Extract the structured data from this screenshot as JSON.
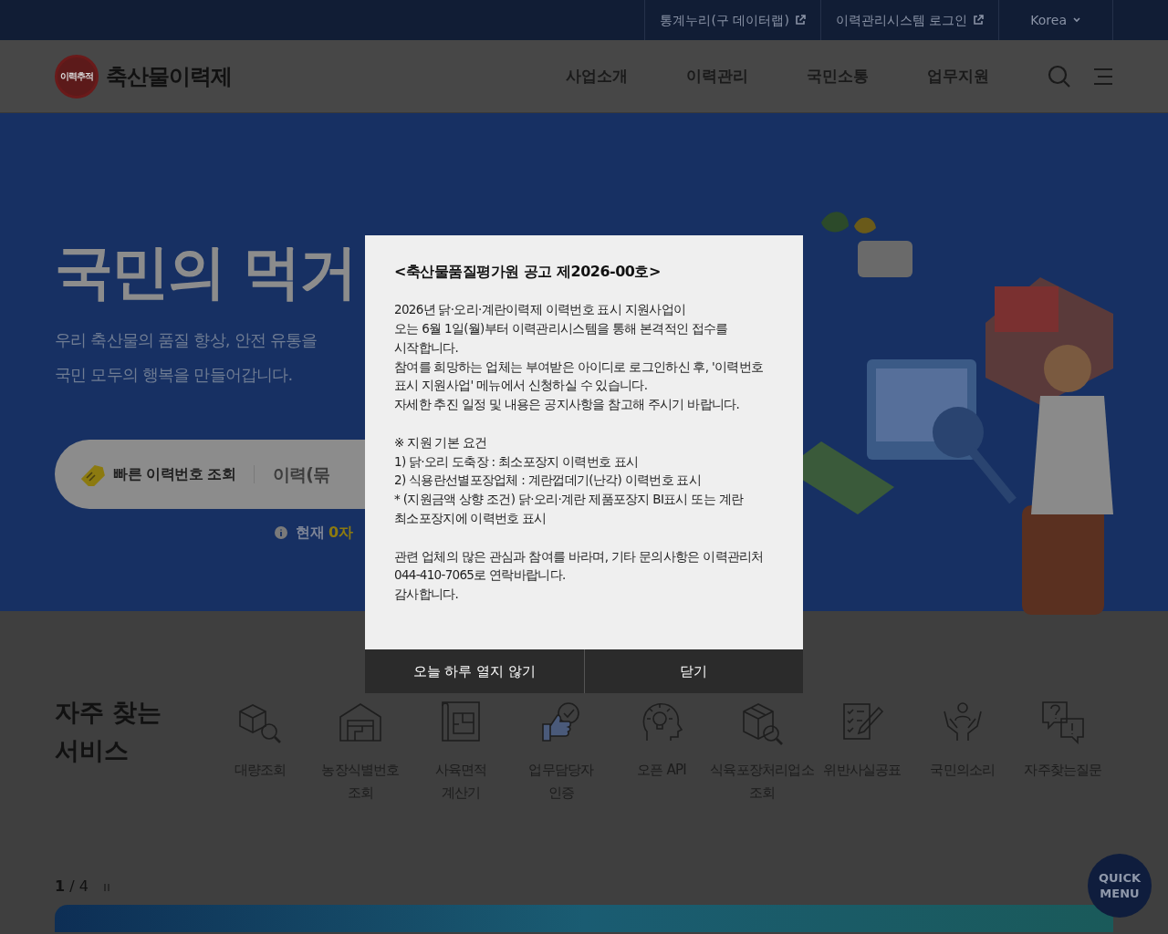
{
  "top_links": [
    {
      "label": "통계누리(구 데이터랩)",
      "kind": "external"
    },
    {
      "label": "이력관리시스템 로그인",
      "kind": "external"
    },
    {
      "label": "Korea",
      "kind": "dropdown"
    }
  ],
  "header": {
    "logo_badge": "이력추적",
    "site_name": "축산물이력제",
    "nav": [
      "사업소개",
      "이력관리",
      "국민소통",
      "업무지원"
    ]
  },
  "hero": {
    "title": "국민의 먹거",
    "subtitle_lines": [
      "우리 축산물의 품질 향상, 안전 유통을",
      "국민 모두의 행복을 만들어갑니다."
    ],
    "search_tab": "빠른 이력번호 조회",
    "search_placeholder": "이력(묶",
    "info_label": "현재",
    "info_count": "0자"
  },
  "services": {
    "title": "자주 찾는\n서비스",
    "items": [
      {
        "label": "대량조회",
        "kind": "lookup"
      },
      {
        "label": "농장식별번호\n조회",
        "kind": "farm"
      },
      {
        "label": "사육면적\n계산기",
        "kind": "calculator"
      },
      {
        "label": "업무담당자\n인증",
        "kind": "certify"
      },
      {
        "label": "오픈 API",
        "kind": "api"
      },
      {
        "label": "식육포장처리업소\n조회",
        "kind": "package"
      },
      {
        "label": "위반사실공표",
        "kind": "violation"
      },
      {
        "label": "국민의소리",
        "kind": "voice"
      },
      {
        "label": "자주찾는질문",
        "kind": "faq"
      }
    ]
  },
  "pager": {
    "current": "1",
    "total": "/ 4"
  },
  "quick_menu": "QUICK\nMENU",
  "modal": {
    "title": "<축산물품질평가원 공고 제2026-00호>",
    "paragraphs": [
      [
        "2026년 닭·오리·계란이력제 이력번호 표시 지원사업이",
        "오는 6월 1일(월)부터 이력관리시스템을 통해 본격적인 접수를",
        "시작합니다.",
        "참여를 희망하는 업체는 부여받은 아이디로 로그인하신 후, '이력번호",
        "표시 지원사업' 메뉴에서 신청하실 수 있습니다.",
        "자세한 추진 일정 및 내용은 공지사항을 참고해 주시기 바랍니다."
      ],
      [
        "※ 지원 기본 요건",
        "1) 닭·오리 도축장 : 최소포장지 이력번호 표시",
        "2) 식용란선별포장업체 : 계란껍데기(난각) 이력번호 표시",
        "* (지원금액 상향 조건) 닭·오리·계란 제품포장지 BI표시 또는 계란",
        "최소포장지에 이력번호 표시"
      ],
      [
        "관련 업체의 많은 관심과 참여를 바라며, 기타 문의사항은 이력관리처",
        "044-410-7065로 연락바랍니다.",
        "감사합니다."
      ]
    ],
    "buttons": [
      "오늘 하루 열지 않기",
      "닫기"
    ]
  }
}
